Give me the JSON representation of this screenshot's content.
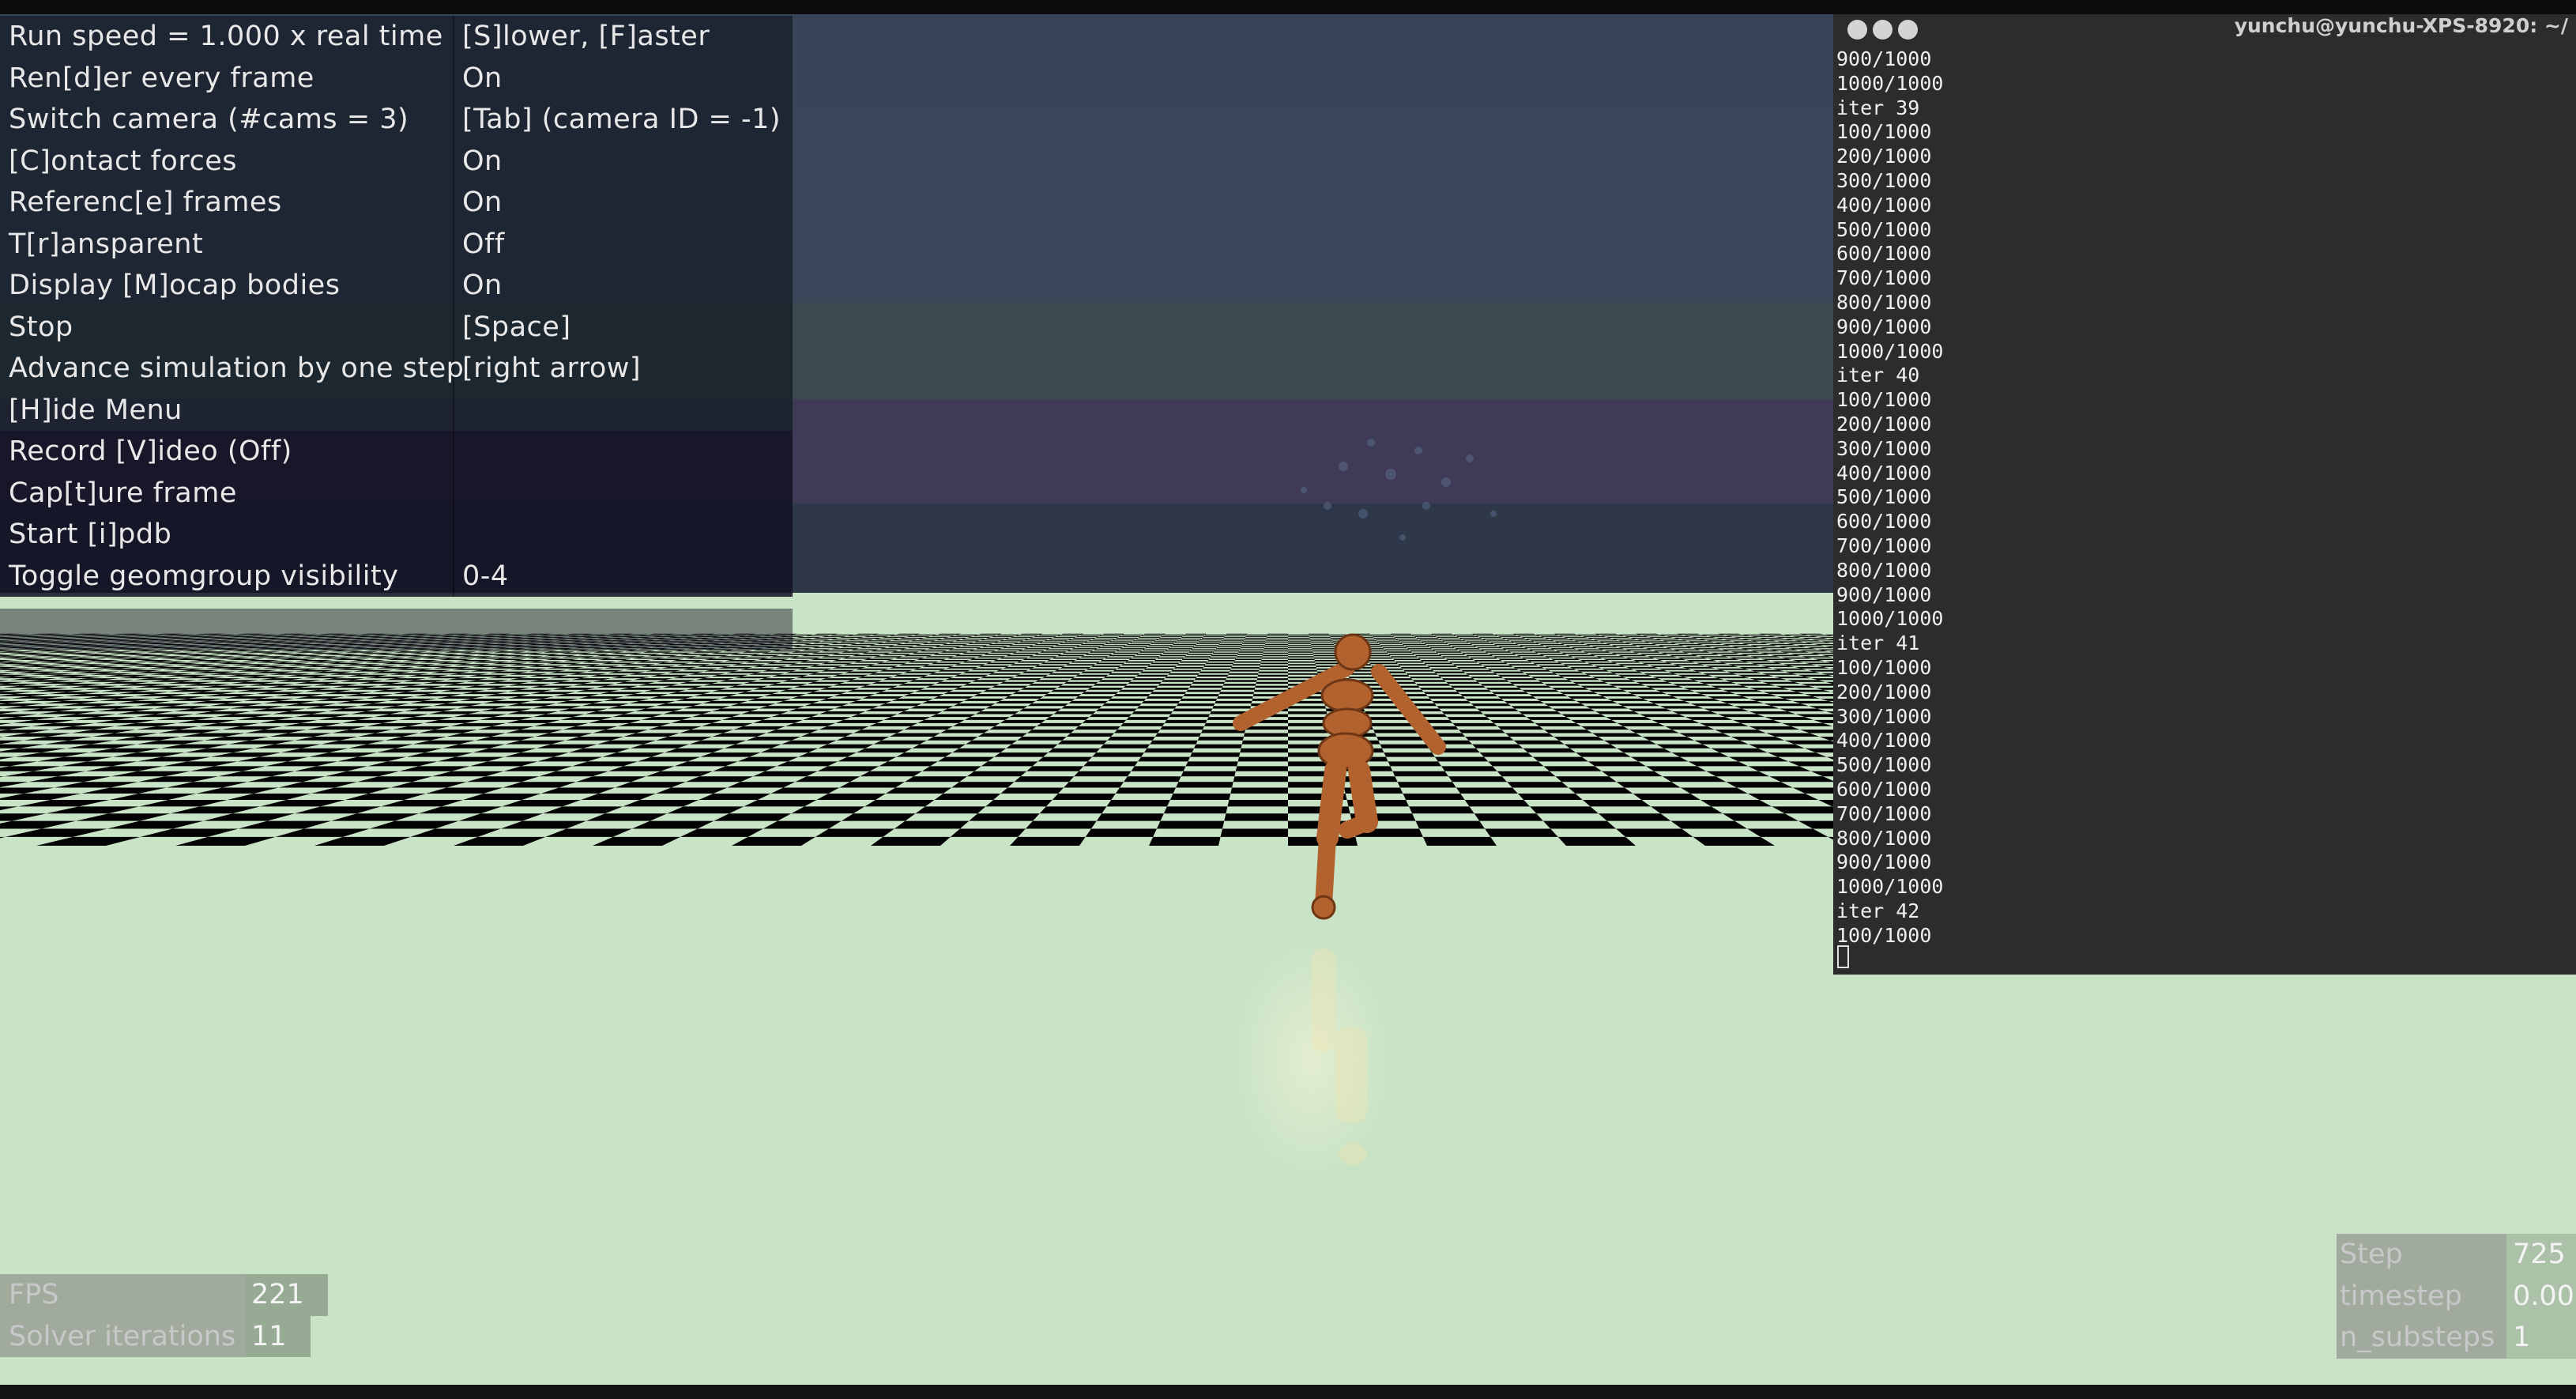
{
  "menu": {
    "rows": [
      {
        "label": "Run speed = 1.000 x real time",
        "value": "[S]lower, [F]aster"
      },
      {
        "label": "Ren[d]er every frame",
        "value": "On"
      },
      {
        "label": "Switch camera (#cams = 3)",
        "value": "[Tab] (camera ID = -1)"
      },
      {
        "label": "[C]ontact forces",
        "value": "On"
      },
      {
        "label": "Referenc[e] frames",
        "value": "On"
      },
      {
        "label": "T[r]ansparent",
        "value": "Off"
      },
      {
        "label": "Display [M]ocap bodies",
        "value": "On"
      },
      {
        "label": "Stop",
        "value": "[Space]"
      },
      {
        "label": "Advance simulation by one step",
        "value": "[right arrow]"
      },
      {
        "label": "[H]ide Menu",
        "value": ""
      },
      {
        "label": "Record [V]ideo (Off)",
        "value": ""
      },
      {
        "label": "Cap[t]ure frame",
        "value": ""
      },
      {
        "label": "Start [i]pdb",
        "value": ""
      },
      {
        "label": "Toggle geomgroup visibility",
        "value": "0-4"
      }
    ]
  },
  "terminal": {
    "title": "yunchu@yunchu-XPS-8920: ~/",
    "lines": [
      "900/1000",
      "1000/1000",
      "iter 39",
      "100/1000",
      "200/1000",
      "300/1000",
      "400/1000",
      "500/1000",
      "600/1000",
      "700/1000",
      "800/1000",
      "900/1000",
      "1000/1000",
      "iter 40",
      "100/1000",
      "200/1000",
      "300/1000",
      "400/1000",
      "500/1000",
      "600/1000",
      "700/1000",
      "800/1000",
      "900/1000",
      "1000/1000",
      "iter 41",
      "100/1000",
      "200/1000",
      "300/1000",
      "400/1000",
      "500/1000",
      "600/1000",
      "700/1000",
      "800/1000",
      "900/1000",
      "1000/1000",
      "iter 42",
      "100/1000"
    ]
  },
  "stats_left": {
    "fps_label": "FPS",
    "fps_value": "221",
    "solver_label": "Solver iterations",
    "solver_value": "11"
  },
  "stats_right": {
    "step_label": "Step",
    "step_value": "725",
    "timestep_label": "timestep",
    "timestep_value": "0.00",
    "substeps_label": "n_substeps",
    "substeps_value": "1"
  },
  "colors": {
    "sky_top": "#384559",
    "checker_light": "#c9e3c6",
    "checker_dark": "#030303",
    "humanoid": "#b2622e",
    "terminal_bg": "#2c2c2c"
  }
}
